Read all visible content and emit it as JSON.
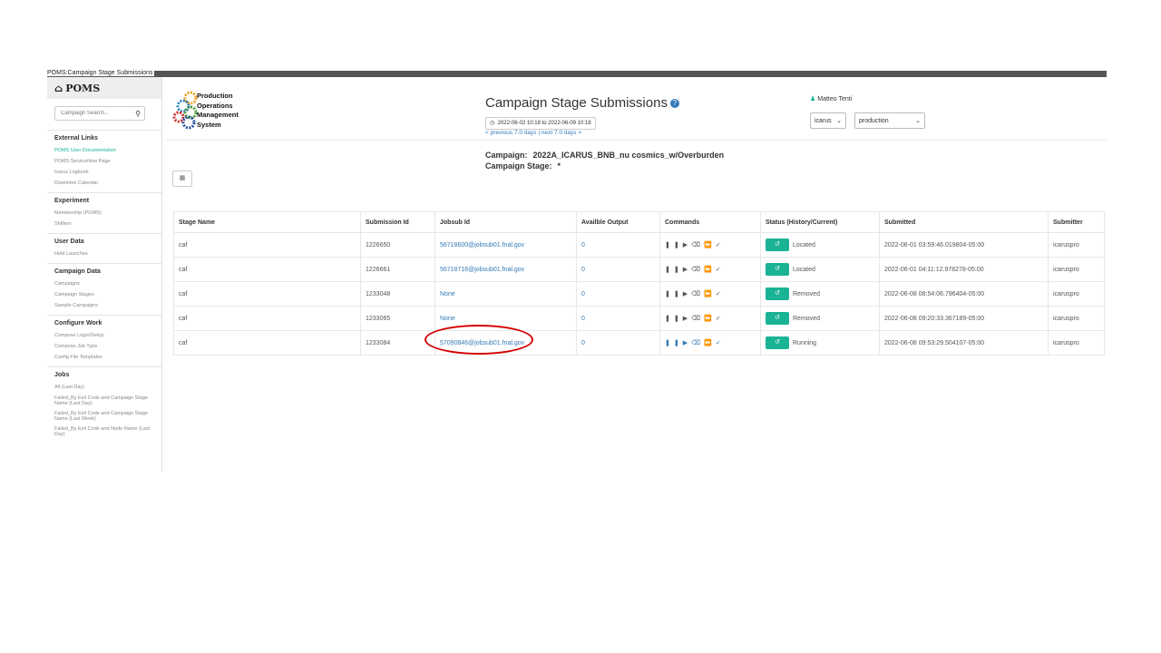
{
  "window": {
    "title": "POMS:Campaign Stage Submissions"
  },
  "sidebar": {
    "brand": "POMS",
    "search_placeholder": "Campaign Search...",
    "sections": [
      {
        "title": "External Links",
        "items": [
          "POMS User Documentation",
          "POMS ServiceNow Page",
          "Icarus Logbook",
          "Downtime Calendar"
        ]
      },
      {
        "title": "Experiment",
        "items": [
          "Membership (POMS)",
          "Shifters"
        ]
      },
      {
        "title": "User Data",
        "items": [
          "Held Launches"
        ]
      },
      {
        "title": "Campaign Data",
        "items": [
          "Campaigns",
          "Campaign Stages",
          "Sample Campaigns"
        ]
      },
      {
        "title": "Configure Work",
        "items": [
          "Compose Login/Setup",
          "Compose Job Type",
          "Config File Templates"
        ]
      },
      {
        "title": "Jobs",
        "items": [
          "All (Last Day)",
          "Failed_By Exit Code and Campaign Stage Name (Last Day)",
          "Failed_By Exit Code and Campaign Stage Name (Last Week)",
          "Failed_By Exit Code and Node Name (Last Day)"
        ]
      }
    ]
  },
  "logo": {
    "lines": [
      "Production",
      "Operations",
      "Management",
      "System"
    ]
  },
  "header": {
    "title": "Campaign Stage Submissions",
    "date_range": "2022-06-02 10:18 to 2022-06-09 10:18",
    "prev_link": "< previous 7.0 days",
    "next_link": "next 7.0 days >",
    "nav_sep": " | ",
    "user": "Matteo Tenti",
    "experiment": "icarus",
    "role": "production"
  },
  "campaign": {
    "campaign_label": "Campaign:",
    "campaign_value": "2022A_ICARUS_BNB_nu cosmics_w/Overburden",
    "stage_label": "Campaign Stage:",
    "stage_value": "*"
  },
  "table": {
    "headers": [
      "Stage Name",
      "Submission Id",
      "Jobsub Id",
      "Availble Output",
      "Commands",
      "Status (History/Current)",
      "Submitted",
      "Submitter"
    ],
    "rows": [
      {
        "stage": "caf",
        "sub_id": "1226650",
        "jobsub": "56718600@jobsub01.fnal.gov",
        "output": "0",
        "status": "Located",
        "submitted": "2022-06-01 03:59:46.019804-05:00",
        "submitter": "icaruspro"
      },
      {
        "stage": "caf",
        "sub_id": "1226661",
        "jobsub": "56718716@jobsub01.fnal.gov",
        "output": "0",
        "status": "Located",
        "submitted": "2022-06-01 04:11:12.978278-05:00",
        "submitter": "icaruspro"
      },
      {
        "stage": "caf",
        "sub_id": "1233048",
        "jobsub": "None",
        "output": "0",
        "status": "Removed",
        "submitted": "2022-06-08 08:54:06.796404-05:00",
        "submitter": "icaruspro"
      },
      {
        "stage": "caf",
        "sub_id": "1233065",
        "jobsub": "None",
        "output": "0",
        "status": "Removed",
        "submitted": "2022-06-08 09:20:33.367189-05:00",
        "submitter": "icaruspro"
      },
      {
        "stage": "caf",
        "sub_id": "1233084",
        "jobsub": "57090846@jobsub01.fnal.gov",
        "output": "0",
        "status": "Running",
        "submitted": "2022-06-08 09:53:29.504107-05:00",
        "submitter": "icaruspro"
      }
    ]
  },
  "colors": {
    "accent": "#1ab394",
    "link": "#337ab7",
    "annotation": "#d40000"
  }
}
